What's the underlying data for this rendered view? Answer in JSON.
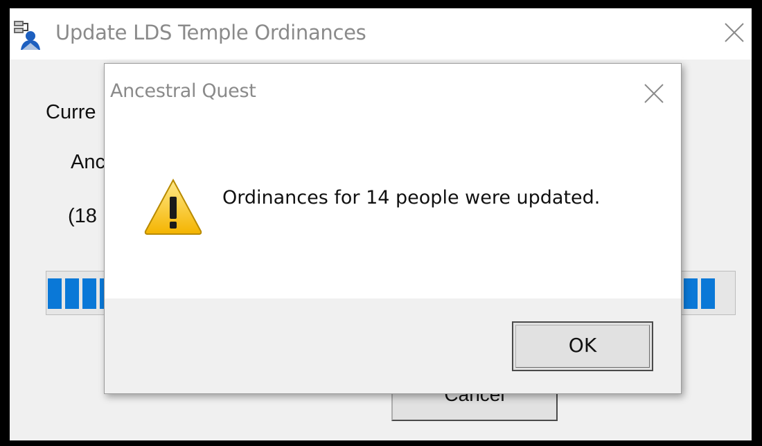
{
  "main_window": {
    "title": "Update LDS Temple Ordinances",
    "icon": "family-tree-app-icon",
    "close_icon": "close-icon",
    "status_label_fragment": "Curre",
    "detail_line_1_fragment": "Anc",
    "detail_line_2_fragment": "(18",
    "cancel_label": "Cancel"
  },
  "progress": {
    "segments_visible": 13,
    "color": "#0a78d7"
  },
  "dialog": {
    "title": "Ancestral Quest",
    "close_icon": "close-icon",
    "icon": "warning-icon",
    "message": "Ordinances for 14 people were updated.",
    "ok_label": "OK"
  }
}
